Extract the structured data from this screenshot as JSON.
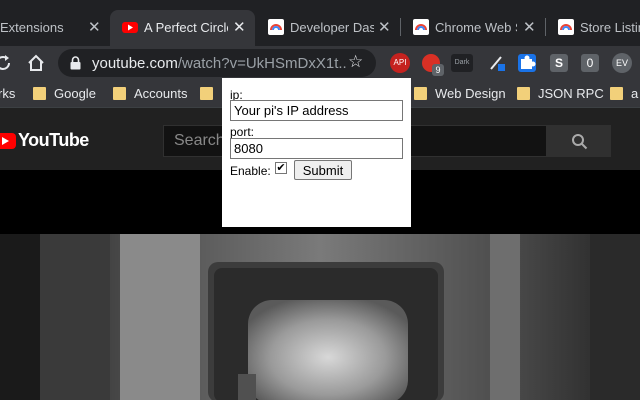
{
  "tabs": [
    {
      "title": "Extensions",
      "close": "✕"
    },
    {
      "title": "A Perfect Circle",
      "close": "✕"
    },
    {
      "title": "Developer Dashb",
      "close": "✕"
    },
    {
      "title": "Chrome Web Sto",
      "close": "✕"
    },
    {
      "title": "Store Listing",
      "close": "✕"
    }
  ],
  "toolbar": {
    "url_host": "youtube.com",
    "url_path": "/watch?v=UkHSmDxX1t...",
    "ext_labels": {
      "api": "API",
      "badge": "9",
      "dark": "Dark",
      "s": "S",
      "zero": "0",
      "profile": "EV"
    }
  },
  "bookmarks": [
    {
      "label": "rks"
    },
    {
      "label": "Google"
    },
    {
      "label": "Accounts"
    },
    {
      "label": "Web Design"
    },
    {
      "label": "JSON RPC"
    },
    {
      "label": "a"
    }
  ],
  "youtube": {
    "logo_text": "YouTube",
    "search_placeholder": "Search"
  },
  "popup": {
    "ip_label": "ip:",
    "ip_value": "Your pi's IP address",
    "port_label": "port:",
    "port_value": "8080",
    "enable_label": "Enable:",
    "enable_checked": true,
    "submit_label": "Submit"
  }
}
